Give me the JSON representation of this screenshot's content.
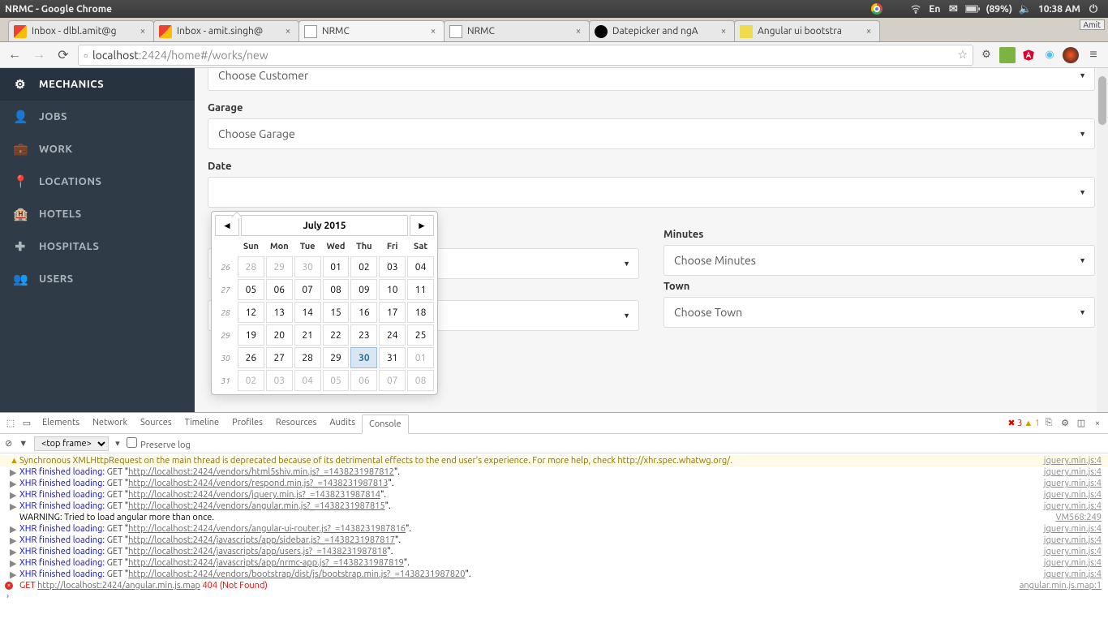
{
  "os": {
    "window_title": "NRMC - Google Chrome",
    "lang": "En",
    "battery": "(89%)",
    "time": "10:38 AM",
    "user_menu": "Amit"
  },
  "tabs": [
    {
      "label": "Inbox - dlbl.amit@g",
      "fav": "gmail"
    },
    {
      "label": "Inbox - amit.singh@",
      "fav": "gmail"
    },
    {
      "label": "NRMC",
      "fav": "page",
      "active": true
    },
    {
      "label": "NRMC",
      "fav": "page"
    },
    {
      "label": "Datepicker and ngA",
      "fav": "gh"
    },
    {
      "label": "Angular ui bootstra",
      "fav": "js"
    }
  ],
  "url": {
    "host": "localhost",
    "rest": ":2424/home#/works/new"
  },
  "sidebar": {
    "items": [
      {
        "icon": "⚙",
        "label": "MECHANICS"
      },
      {
        "icon": "👤",
        "label": "JOBS"
      },
      {
        "icon": "💼",
        "label": "WORK"
      },
      {
        "icon": "📍",
        "label": "LOCATIONS"
      },
      {
        "icon": "🏨",
        "label": "HOTELS"
      },
      {
        "icon": "✚",
        "label": "HOSPITALS"
      },
      {
        "icon": "👥",
        "label": "USERS"
      }
    ]
  },
  "form": {
    "customer_placeholder": "Choose Customer",
    "garage_label": "Garage",
    "garage_placeholder": "Choose Garage",
    "date_label": "Date",
    "minutes_label": "Minutes",
    "minutes_placeholder": "Choose Minutes",
    "town_label": "Town",
    "town_placeholder": "Choose Town"
  },
  "datepicker": {
    "title": "July 2015",
    "dow": [
      "Sun",
      "Mon",
      "Tue",
      "Wed",
      "Thu",
      "Fri",
      "Sat"
    ],
    "weeks": [
      {
        "wk": "26",
        "days": [
          {
            "d": "28",
            "m": 1
          },
          {
            "d": "29",
            "m": 1
          },
          {
            "d": "30",
            "m": 1
          },
          {
            "d": "01"
          },
          {
            "d": "02"
          },
          {
            "d": "03"
          },
          {
            "d": "04"
          }
        ]
      },
      {
        "wk": "27",
        "days": [
          {
            "d": "05"
          },
          {
            "d": "06"
          },
          {
            "d": "07"
          },
          {
            "d": "08"
          },
          {
            "d": "09"
          },
          {
            "d": "10"
          },
          {
            "d": "11"
          }
        ]
      },
      {
        "wk": "28",
        "days": [
          {
            "d": "12"
          },
          {
            "d": "13"
          },
          {
            "d": "14"
          },
          {
            "d": "15"
          },
          {
            "d": "16"
          },
          {
            "d": "17"
          },
          {
            "d": "18"
          }
        ]
      },
      {
        "wk": "29",
        "days": [
          {
            "d": "19"
          },
          {
            "d": "20"
          },
          {
            "d": "21"
          },
          {
            "d": "22"
          },
          {
            "d": "23"
          },
          {
            "d": "24"
          },
          {
            "d": "25"
          }
        ]
      },
      {
        "wk": "30",
        "days": [
          {
            "d": "26"
          },
          {
            "d": "27"
          },
          {
            "d": "28"
          },
          {
            "d": "29"
          },
          {
            "d": "30",
            "today": 1
          },
          {
            "d": "31"
          },
          {
            "d": "01",
            "m": 1
          }
        ]
      },
      {
        "wk": "31",
        "days": [
          {
            "d": "02",
            "m": 1
          },
          {
            "d": "03",
            "m": 1
          },
          {
            "d": "04",
            "m": 1
          },
          {
            "d": "05",
            "m": 1
          },
          {
            "d": "06",
            "m": 1
          },
          {
            "d": "07",
            "m": 1
          },
          {
            "d": "08",
            "m": 1
          }
        ]
      }
    ]
  },
  "devtools": {
    "tabs": [
      "Elements",
      "Network",
      "Sources",
      "Timeline",
      "Profiles",
      "Resources",
      "Audits",
      "Console"
    ],
    "active_tab": "Console",
    "errors": "3",
    "warnings": "1",
    "top_frame": "<top frame>",
    "preserve_log": "Preserve log",
    "lines": [
      {
        "type": "warn",
        "text": "Synchronous XMLHttpRequest on the main thread is deprecated because of its detrimental effects to the end user's experience. For more help, check http://xhr.spec.whatwg.org/.",
        "src": "jquery.min.js:4"
      },
      {
        "type": "xhr",
        "url": "http://localhost:2424/vendors/html5shiv.min.js?_=1438231987812",
        "src": "jquery.min.js:4"
      },
      {
        "type": "xhr",
        "url": "http://localhost:2424/vendors/respond.min.js?_=1438231987813",
        "src": "jquery.min.js:4"
      },
      {
        "type": "xhr",
        "url": "http://localhost:2424/vendors/jquery.min.js?_=1438231987814",
        "src": "jquery.min.js:4"
      },
      {
        "type": "xhr",
        "url": "http://localhost:2424/vendors/angular.min.js?_=1438231987815",
        "src": "jquery.min.js:4"
      },
      {
        "type": "plain",
        "text": "WARNING: Tried to load angular more than once.",
        "src": "VM568:249"
      },
      {
        "type": "xhr",
        "url": "http://localhost:2424/vendors/angular-ui-router.js?_=1438231987816",
        "src": "jquery.min.js:4"
      },
      {
        "type": "xhr",
        "url": "http://localhost:2424/javascripts/app/sidebar.js?_=1438231987817",
        "src": "jquery.min.js:4"
      },
      {
        "type": "xhr",
        "url": "http://localhost:2424/javascripts/app/users.js?_=1438231987818",
        "src": "jquery.min.js:4"
      },
      {
        "type": "xhr",
        "url": "http://localhost:2424/javascripts/app/nrmc-app.js?_=1438231987819",
        "src": "jquery.min.js:4"
      },
      {
        "type": "xhr",
        "url": "http://localhost:2424/vendors/bootstrap/dist/js/bootstrap.min.js?_=1438231987820",
        "src": "jquery.min.js:4"
      },
      {
        "type": "err",
        "text": "GET ",
        "url": "http://localhost:2424/angular.min.js.map",
        "tail": " 404 (Not Found)",
        "src": "angular.min.js.map:1"
      }
    ]
  }
}
